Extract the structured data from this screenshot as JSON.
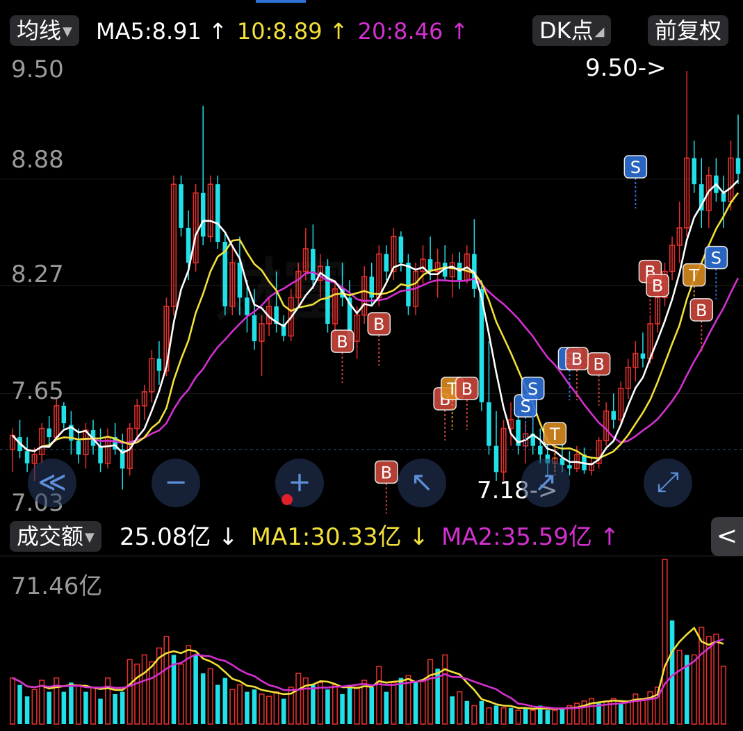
{
  "toolbar": {
    "indicator_selector": "均线",
    "dk_button": "DK点",
    "adjust_button": "前复权"
  },
  "ma_legend": {
    "ma5": "MA5:8.91 ↑",
    "ma10": "10:8.89 ↑",
    "ma20": "20:8.46 ↑"
  },
  "colors": {
    "up": "#e0302c",
    "down": "#22e0e8",
    "ma5": "#ffffff",
    "ma10": "#f2e03a",
    "ma20": "#d330d0",
    "buy_marker": "#c9453b",
    "sell_marker": "#2f6fd6",
    "t_marker": "#d88a20"
  },
  "price_axis": {
    "ticks": [
      "9.50",
      "8.88",
      "8.27",
      "7.65",
      "7.03"
    ]
  },
  "annotations": {
    "high_label": "9.50->",
    "low_label": "7.18->"
  },
  "volume_panel": {
    "selector": "成交额",
    "value": "25.08亿 ↓",
    "ma1": "MA1:30.33亿 ↓",
    "ma2": "MA2:35.59亿 ↑",
    "max_label": "71.46亿"
  },
  "nav_buttons": {
    "scroll_left": "≪",
    "zoom_out": "−",
    "zoom_in": "+",
    "pan": "↖",
    "cursor": "↗",
    "fullscreen": "⤢",
    "collapse": "<"
  },
  "watermark": "财富",
  "chart_data": {
    "type": "candlestick",
    "title": "",
    "ylim": [
      7.03,
      9.5
    ],
    "volume_max": 71.46,
    "volume_unit": "亿",
    "candles": [
      {
        "o": 7.33,
        "h": 7.45,
        "l": 7.2,
        "c": 7.41
      },
      {
        "o": 7.4,
        "h": 7.5,
        "l": 7.28,
        "c": 7.32
      },
      {
        "o": 7.32,
        "h": 7.4,
        "l": 7.2,
        "c": 7.25
      },
      {
        "o": 7.25,
        "h": 7.34,
        "l": 7.15,
        "c": 7.3
      },
      {
        "o": 7.3,
        "h": 7.48,
        "l": 7.25,
        "c": 7.45
      },
      {
        "o": 7.45,
        "h": 7.52,
        "l": 7.35,
        "c": 7.4
      },
      {
        "o": 7.4,
        "h": 7.62,
        "l": 7.38,
        "c": 7.58
      },
      {
        "o": 7.58,
        "h": 7.6,
        "l": 7.45,
        "c": 7.48
      },
      {
        "o": 7.47,
        "h": 7.55,
        "l": 7.3,
        "c": 7.38
      },
      {
        "o": 7.38,
        "h": 7.45,
        "l": 7.25,
        "c": 7.3
      },
      {
        "o": 7.3,
        "h": 7.48,
        "l": 7.22,
        "c": 7.44
      },
      {
        "o": 7.44,
        "h": 7.5,
        "l": 7.3,
        "c": 7.35
      },
      {
        "o": 7.35,
        "h": 7.45,
        "l": 7.2,
        "c": 7.25
      },
      {
        "o": 7.25,
        "h": 7.45,
        "l": 7.22,
        "c": 7.4
      },
      {
        "o": 7.4,
        "h": 7.48,
        "l": 7.3,
        "c": 7.33
      },
      {
        "o": 7.33,
        "h": 7.42,
        "l": 7.1,
        "c": 7.22
      },
      {
        "o": 7.22,
        "h": 7.48,
        "l": 7.18,
        "c": 7.45
      },
      {
        "o": 7.45,
        "h": 7.62,
        "l": 7.4,
        "c": 7.58
      },
      {
        "o": 7.58,
        "h": 7.7,
        "l": 7.5,
        "c": 7.66
      },
      {
        "o": 7.66,
        "h": 7.9,
        "l": 7.6,
        "c": 7.85
      },
      {
        "o": 7.85,
        "h": 7.95,
        "l": 7.7,
        "c": 7.78
      },
      {
        "o": 7.78,
        "h": 8.2,
        "l": 7.75,
        "c": 8.15
      },
      {
        "o": 8.15,
        "h": 8.9,
        "l": 8.1,
        "c": 8.85
      },
      {
        "o": 8.85,
        "h": 8.9,
        "l": 8.55,
        "c": 8.6
      },
      {
        "o": 8.6,
        "h": 8.7,
        "l": 8.3,
        "c": 8.4
      },
      {
        "o": 8.4,
        "h": 8.85,
        "l": 8.35,
        "c": 8.8
      },
      {
        "o": 8.8,
        "h": 9.3,
        "l": 8.5,
        "c": 8.55
      },
      {
        "o": 8.55,
        "h": 8.9,
        "l": 8.52,
        "c": 8.85
      },
      {
        "o": 8.85,
        "h": 8.9,
        "l": 8.48,
        "c": 8.52
      },
      {
        "o": 8.52,
        "h": 8.58,
        "l": 8.1,
        "c": 8.15
      },
      {
        "o": 8.15,
        "h": 8.5,
        "l": 8.1,
        "c": 8.4
      },
      {
        "o": 8.4,
        "h": 8.55,
        "l": 8.1,
        "c": 8.2
      },
      {
        "o": 8.2,
        "h": 8.3,
        "l": 8.0,
        "c": 8.1
      },
      {
        "o": 8.1,
        "h": 8.25,
        "l": 7.9,
        "c": 7.95
      },
      {
        "o": 7.95,
        "h": 8.1,
        "l": 7.75,
        "c": 8.05
      },
      {
        "o": 8.05,
        "h": 8.2,
        "l": 7.98,
        "c": 8.15
      },
      {
        "o": 8.15,
        "h": 8.35,
        "l": 8.0,
        "c": 8.05
      },
      {
        "o": 8.05,
        "h": 8.1,
        "l": 7.95,
        "c": 7.98
      },
      {
        "o": 7.98,
        "h": 8.25,
        "l": 7.95,
        "c": 8.2
      },
      {
        "o": 8.2,
        "h": 8.4,
        "l": 8.15,
        "c": 8.35
      },
      {
        "o": 8.35,
        "h": 8.6,
        "l": 8.3,
        "c": 8.48
      },
      {
        "o": 8.48,
        "h": 8.62,
        "l": 8.25,
        "c": 8.3
      },
      {
        "o": 8.3,
        "h": 8.45,
        "l": 8.2,
        "c": 8.38
      },
      {
        "o": 8.38,
        "h": 8.42,
        "l": 8.0,
        "c": 8.05
      },
      {
        "o": 8.05,
        "h": 8.3,
        "l": 7.95,
        "c": 8.25
      },
      {
        "o": 8.25,
        "h": 8.4,
        "l": 8.15,
        "c": 8.2
      },
      {
        "o": 8.2,
        "h": 8.3,
        "l": 7.9,
        "c": 7.95
      },
      {
        "o": 7.95,
        "h": 8.15,
        "l": 7.85,
        "c": 8.1
      },
      {
        "o": 8.1,
        "h": 8.38,
        "l": 8.05,
        "c": 8.32
      },
      {
        "o": 8.32,
        "h": 8.4,
        "l": 8.15,
        "c": 8.2
      },
      {
        "o": 8.2,
        "h": 8.5,
        "l": 8.15,
        "c": 8.45
      },
      {
        "o": 8.45,
        "h": 8.5,
        "l": 8.3,
        "c": 8.35
      },
      {
        "o": 8.35,
        "h": 8.6,
        "l": 8.3,
        "c": 8.55
      },
      {
        "o": 8.55,
        "h": 8.58,
        "l": 8.35,
        "c": 8.4
      },
      {
        "o": 8.4,
        "h": 8.45,
        "l": 8.1,
        "c": 8.15
      },
      {
        "o": 8.15,
        "h": 8.4,
        "l": 8.1,
        "c": 8.35
      },
      {
        "o": 8.35,
        "h": 8.5,
        "l": 8.28,
        "c": 8.42
      },
      {
        "o": 8.42,
        "h": 8.55,
        "l": 8.3,
        "c": 8.35
      },
      {
        "o": 8.35,
        "h": 8.48,
        "l": 8.2,
        "c": 8.4
      },
      {
        "o": 8.4,
        "h": 8.5,
        "l": 8.3,
        "c": 8.32
      },
      {
        "o": 8.32,
        "h": 8.45,
        "l": 8.2,
        "c": 8.4
      },
      {
        "o": 8.4,
        "h": 8.46,
        "l": 8.25,
        "c": 8.3
      },
      {
        "o": 8.3,
        "h": 8.5,
        "l": 8.28,
        "c": 8.45
      },
      {
        "o": 8.45,
        "h": 8.65,
        "l": 8.2,
        "c": 8.25
      },
      {
        "o": 8.25,
        "h": 8.3,
        "l": 7.55,
        "c": 7.6
      },
      {
        "o": 7.6,
        "h": 7.95,
        "l": 7.3,
        "c": 7.35
      },
      {
        "o": 7.35,
        "h": 7.55,
        "l": 7.15,
        "c": 7.2
      },
      {
        "o": 7.2,
        "h": 7.5,
        "l": 7.15,
        "c": 7.45
      },
      {
        "o": 7.45,
        "h": 7.6,
        "l": 7.35,
        "c": 7.5
      },
      {
        "o": 7.5,
        "h": 7.55,
        "l": 7.3,
        "c": 7.35
      },
      {
        "o": 7.35,
        "h": 7.48,
        "l": 7.25,
        "c": 7.42
      },
      {
        "o": 7.42,
        "h": 7.55,
        "l": 7.3,
        "c": 7.35
      },
      {
        "o": 7.35,
        "h": 7.45,
        "l": 7.25,
        "c": 7.3
      },
      {
        "o": 7.3,
        "h": 7.4,
        "l": 7.18,
        "c": 7.25
      },
      {
        "o": 7.25,
        "h": 7.35,
        "l": 7.2,
        "c": 7.28
      },
      {
        "o": 7.28,
        "h": 7.38,
        "l": 7.2,
        "c": 7.24
      },
      {
        "o": 7.24,
        "h": 7.32,
        "l": 7.18,
        "c": 7.22
      },
      {
        "o": 7.22,
        "h": 7.35,
        "l": 7.2,
        "c": 7.3
      },
      {
        "o": 7.3,
        "h": 7.34,
        "l": 7.19,
        "c": 7.21
      },
      {
        "o": 7.21,
        "h": 7.28,
        "l": 7.18,
        "c": 7.25
      },
      {
        "o": 7.25,
        "h": 7.4,
        "l": 7.22,
        "c": 7.38
      },
      {
        "o": 7.38,
        "h": 7.6,
        "l": 7.35,
        "c": 7.55
      },
      {
        "o": 7.55,
        "h": 7.65,
        "l": 7.45,
        "c": 7.5
      },
      {
        "o": 7.5,
        "h": 7.72,
        "l": 7.48,
        "c": 7.68
      },
      {
        "o": 7.68,
        "h": 7.85,
        "l": 7.62,
        "c": 7.8
      },
      {
        "o": 7.8,
        "h": 7.95,
        "l": 7.72,
        "c": 7.88
      },
      {
        "o": 7.88,
        "h": 8.0,
        "l": 7.8,
        "c": 7.85
      },
      {
        "o": 7.85,
        "h": 8.1,
        "l": 7.82,
        "c": 8.05
      },
      {
        "o": 8.05,
        "h": 8.25,
        "l": 8.0,
        "c": 8.2
      },
      {
        "o": 8.2,
        "h": 8.4,
        "l": 8.15,
        "c": 8.35
      },
      {
        "o": 8.35,
        "h": 8.55,
        "l": 8.3,
        "c": 8.5
      },
      {
        "o": 8.5,
        "h": 8.75,
        "l": 8.4,
        "c": 8.6
      },
      {
        "o": 8.6,
        "h": 9.5,
        "l": 8.55,
        "c": 9.0
      },
      {
        "o": 9.0,
        "h": 9.1,
        "l": 8.8,
        "c": 8.85
      },
      {
        "o": 8.85,
        "h": 9.0,
        "l": 8.6,
        "c": 8.7
      },
      {
        "o": 8.7,
        "h": 8.95,
        "l": 8.6,
        "c": 8.9
      },
      {
        "o": 8.9,
        "h": 9.0,
        "l": 8.75,
        "c": 8.8
      },
      {
        "o": 8.8,
        "h": 8.9,
        "l": 8.6,
        "c": 8.75
      },
      {
        "o": 8.75,
        "h": 9.1,
        "l": 8.7,
        "c": 9.0
      },
      {
        "o": 9.0,
        "h": 9.25,
        "l": 8.85,
        "c": 8.91
      }
    ],
    "volume": [
      {
        "v": 20,
        "up": true
      },
      {
        "v": 17,
        "up": false
      },
      {
        "v": 12,
        "up": false
      },
      {
        "v": 15,
        "up": true
      },
      {
        "v": 19,
        "up": true
      },
      {
        "v": 14,
        "up": false
      },
      {
        "v": 20,
        "up": true
      },
      {
        "v": 14,
        "up": false
      },
      {
        "v": 18,
        "up": false
      },
      {
        "v": 17,
        "up": true
      },
      {
        "v": 14,
        "up": false
      },
      {
        "v": 16,
        "up": true
      },
      {
        "v": 11,
        "up": false
      },
      {
        "v": 20,
        "up": true
      },
      {
        "v": 13,
        "up": false
      },
      {
        "v": 14,
        "up": false
      },
      {
        "v": 28,
        "up": true
      },
      {
        "v": 26,
        "up": true
      },
      {
        "v": 30,
        "up": true
      },
      {
        "v": 27,
        "up": true
      },
      {
        "v": 33,
        "up": true
      },
      {
        "v": 38,
        "up": true
      },
      {
        "v": 30,
        "up": false
      },
      {
        "v": 26,
        "up": true
      },
      {
        "v": 34,
        "up": true
      },
      {
        "v": 30,
        "up": false
      },
      {
        "v": 22,
        "up": false
      },
      {
        "v": 24,
        "up": true
      },
      {
        "v": 17,
        "up": false
      },
      {
        "v": 20,
        "up": false
      },
      {
        "v": 15,
        "up": true
      },
      {
        "v": 17,
        "up": true
      },
      {
        "v": 14,
        "up": false
      },
      {
        "v": 15,
        "up": false
      },
      {
        "v": 13,
        "up": true
      },
      {
        "v": 12,
        "up": true
      },
      {
        "v": 14,
        "up": true
      },
      {
        "v": 11,
        "up": false
      },
      {
        "v": 16,
        "up": true
      },
      {
        "v": 22,
        "up": true
      },
      {
        "v": 20,
        "up": true
      },
      {
        "v": 17,
        "up": false
      },
      {
        "v": 18,
        "up": true
      },
      {
        "v": 15,
        "up": false
      },
      {
        "v": 17,
        "up": true
      },
      {
        "v": 13,
        "up": false
      },
      {
        "v": 17,
        "up": false
      },
      {
        "v": 16,
        "up": true
      },
      {
        "v": 19,
        "up": true
      },
      {
        "v": 16,
        "up": false
      },
      {
        "v": 25,
        "up": true
      },
      {
        "v": 14,
        "up": false
      },
      {
        "v": 18,
        "up": true
      },
      {
        "v": 20,
        "up": false
      },
      {
        "v": 21,
        "up": true
      },
      {
        "v": 18,
        "up": false
      },
      {
        "v": 19,
        "up": true
      },
      {
        "v": 28,
        "up": true
      },
      {
        "v": 24,
        "up": false
      },
      {
        "v": 30,
        "up": true
      },
      {
        "v": 12,
        "up": false
      },
      {
        "v": 14,
        "up": true
      },
      {
        "v": 10,
        "up": false
      },
      {
        "v": 8,
        "up": true
      },
      {
        "v": 10,
        "up": false
      },
      {
        "v": 7,
        "up": true
      },
      {
        "v": 8,
        "up": false
      },
      {
        "v": 7,
        "up": true
      },
      {
        "v": 7,
        "up": false
      },
      {
        "v": 6,
        "up": true
      },
      {
        "v": 7,
        "up": false
      },
      {
        "v": 6,
        "up": true
      },
      {
        "v": 8,
        "up": false
      },
      {
        "v": 6,
        "up": false
      },
      {
        "v": 6,
        "up": true
      },
      {
        "v": 7,
        "up": false
      },
      {
        "v": 8,
        "up": true
      },
      {
        "v": 9,
        "up": true
      },
      {
        "v": 10,
        "up": true
      },
      {
        "v": 11,
        "up": true
      },
      {
        "v": 9,
        "up": false
      },
      {
        "v": 10,
        "up": true
      },
      {
        "v": 11,
        "up": true
      },
      {
        "v": 9,
        "up": false
      },
      {
        "v": 10,
        "up": true
      },
      {
        "v": 13,
        "up": true
      },
      {
        "v": 11,
        "up": true
      },
      {
        "v": 14,
        "up": true
      },
      {
        "v": 16,
        "up": true
      },
      {
        "v": 71.46,
        "up": true
      },
      {
        "v": 45,
        "up": false
      },
      {
        "v": 32,
        "up": true
      },
      {
        "v": 30,
        "up": false
      },
      {
        "v": 30,
        "up": true
      },
      {
        "v": 42,
        "up": true
      },
      {
        "v": 38,
        "up": true
      },
      {
        "v": 39,
        "up": true
      },
      {
        "v": 25.08,
        "up": true
      }
    ]
  }
}
